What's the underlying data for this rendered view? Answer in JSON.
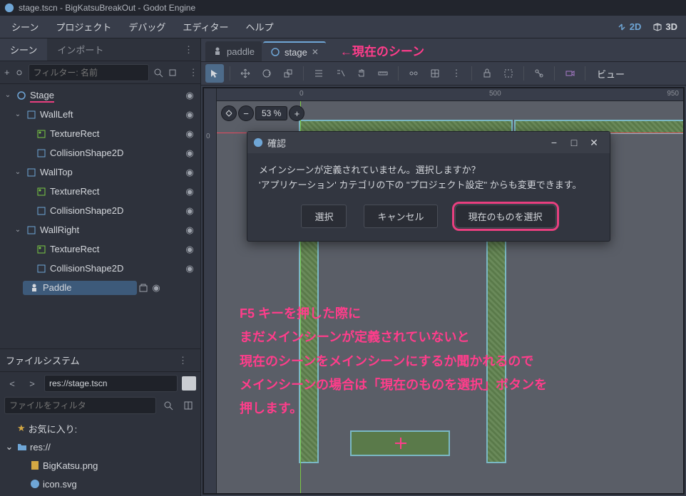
{
  "title": "stage.tscn - BigKatsuBreakOut - Godot Engine",
  "menu": {
    "scene": "シーン",
    "project": "プロジェクト",
    "debug": "デバッグ",
    "editor": "エディター",
    "help": "ヘルプ"
  },
  "mode": {
    "d2": "2D",
    "d3": "3D"
  },
  "dock": {
    "scene_tab": "シーン",
    "import_tab": "インポート",
    "filter_placeholder": "フィルター: 名前"
  },
  "tree": {
    "root": "Stage",
    "wall_left": "WallLeft",
    "wall_top": "WallTop",
    "wall_right": "WallRight",
    "texture_rect": "TextureRect",
    "collision": "CollisionShape2D",
    "paddle": "Paddle"
  },
  "fs": {
    "title": "ファイルシステム",
    "path": "res://stage.tscn",
    "filter": "ファイルをフィルタ",
    "favorites": "お気に入り:",
    "root": "res://",
    "file1": "BigKatsu.png",
    "file2": "icon.svg"
  },
  "tabs": {
    "paddle": "paddle",
    "stage": "stage"
  },
  "annotation_tab": "←現在のシーン",
  "viewport": {
    "zoom": "53 %",
    "view_btn": "ビュー",
    "ruler0": "0",
    "ruler500": "500",
    "ruler950": "950"
  },
  "dialog": {
    "title": "確認",
    "line1": "メインシーンが定義されていません。選択しますか？",
    "line2": "'アプリケーション' カテゴリの下の \"プロジェクト設定\" からも変更できます。",
    "btn_select": "選択",
    "btn_cancel": "キャンセル",
    "btn_current": "現在のものを選択"
  },
  "big_annotation": {
    "l1": "F5 キーを押した際に",
    "l2": "まだメインシーンが定義されていないと",
    "l3": "現在のシーンをメインシーンにするか聞かれるので",
    "l4": "メインシーンの場合は「現在のものを選択」ボタンを",
    "l5": "押します。"
  }
}
